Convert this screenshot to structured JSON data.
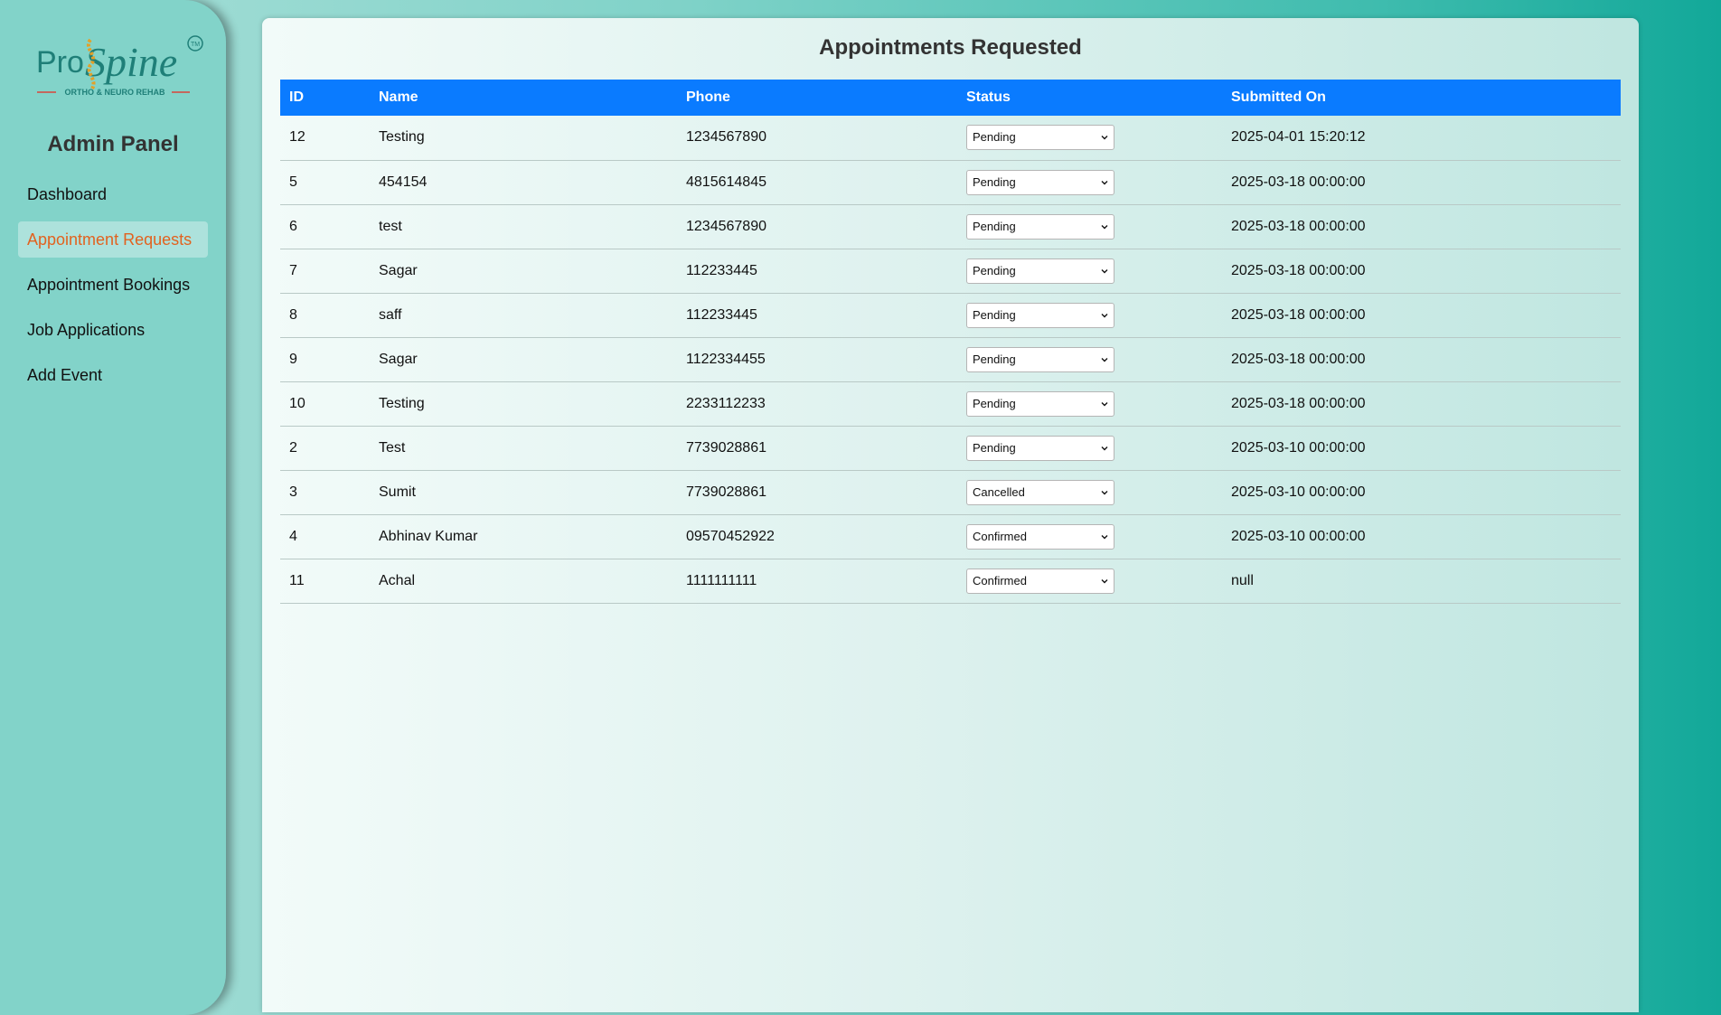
{
  "logo": {
    "brand_pro": "Pro",
    "brand_spine": "Spine",
    "trademark": "TM",
    "tagline": "ORTHO & NEURO REHAB",
    "colors": {
      "teal": "#1f7f78",
      "gold": "#e2a12a",
      "red": "#d9443a"
    }
  },
  "sidebar": {
    "title": "Admin Panel",
    "items": [
      {
        "label": "Dashboard",
        "active": false
      },
      {
        "label": "Appointment Requests",
        "active": true
      },
      {
        "label": "Appointment Bookings",
        "active": false
      },
      {
        "label": "Job Applications",
        "active": false
      },
      {
        "label": "Add Event",
        "active": false
      }
    ]
  },
  "main": {
    "title": "Appointments Requested",
    "columns": [
      "ID",
      "Name",
      "Phone",
      "Status",
      "Submitted On"
    ],
    "rows": [
      {
        "id": "12",
        "name": "Testing",
        "phone": "1234567890",
        "status": "Pending",
        "submitted": "2025-04-01 15:20:12"
      },
      {
        "id": "5",
        "name": "454154",
        "phone": "4815614845",
        "status": "Pending",
        "submitted": "2025-03-18 00:00:00"
      },
      {
        "id": "6",
        "name": "test",
        "phone": "1234567890",
        "status": "Pending",
        "submitted": "2025-03-18 00:00:00"
      },
      {
        "id": "7",
        "name": "Sagar",
        "phone": "112233445",
        "status": "Pending",
        "submitted": "2025-03-18 00:00:00"
      },
      {
        "id": "8",
        "name": "saff",
        "phone": "112233445",
        "status": "Pending",
        "submitted": "2025-03-18 00:00:00"
      },
      {
        "id": "9",
        "name": "Sagar",
        "phone": "1122334455",
        "status": "Pending",
        "submitted": "2025-03-18 00:00:00"
      },
      {
        "id": "10",
        "name": "Testing",
        "phone": "2233112233",
        "status": "Pending",
        "submitted": "2025-03-18 00:00:00"
      },
      {
        "id": "2",
        "name": "Test",
        "phone": "7739028861",
        "status": "Pending",
        "submitted": "2025-03-10 00:00:00"
      },
      {
        "id": "3",
        "name": "Sumit",
        "phone": "7739028861",
        "status": "Cancelled",
        "submitted": "2025-03-10 00:00:00"
      },
      {
        "id": "4",
        "name": "Abhinav Kumar",
        "phone": "09570452922",
        "status": "Confirmed",
        "submitted": "2025-03-10 00:00:00"
      },
      {
        "id": "11",
        "name": "Achal",
        "phone": "1111111111",
        "status": "Confirmed",
        "submitted": "null"
      }
    ]
  },
  "colors": {
    "header_bg": "#0a7bff",
    "active_nav_text": "#e2621f",
    "sidebar_bg": "#82d3c9"
  }
}
